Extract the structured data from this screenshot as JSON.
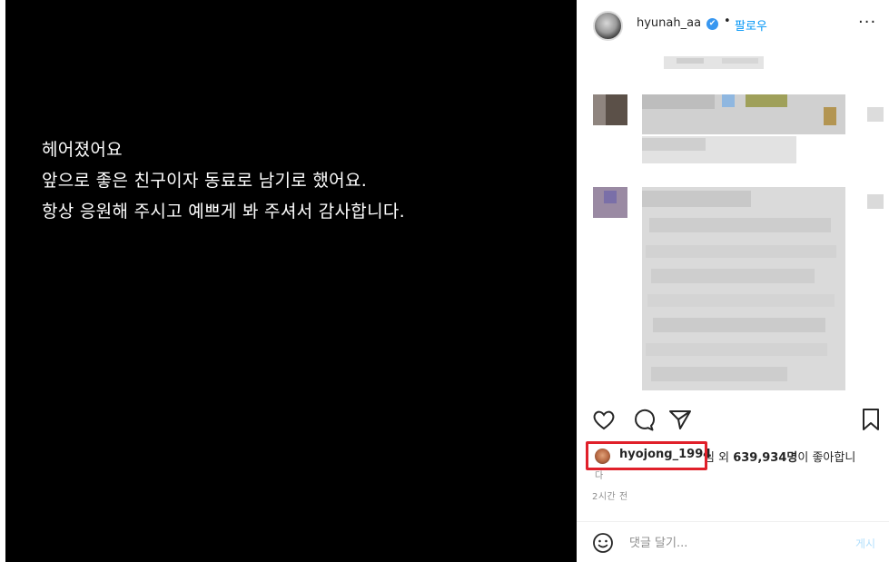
{
  "post": {
    "lines": [
      "헤어졌어요",
      "앞으로 좋은 친구이자 동료로 남기로 했어요.",
      "항상 응원해 주시고 예쁘게 봐 주셔서 감사합니다."
    ]
  },
  "header": {
    "username": "hyunah_aa",
    "verified_mark": "✔",
    "separator": "•",
    "follow_label": "팔로우",
    "more_label": "···"
  },
  "likes": {
    "liker_name": "hyojong_1994",
    "rest_prefix": "님 외 ",
    "count": "639,934명",
    "rest_suffix": "이 좋아합니",
    "continuation": "다"
  },
  "meta": {
    "time_ago": "2시간 전"
  },
  "comment": {
    "placeholder": "댓글 달기...",
    "post_label": "게시"
  },
  "icons": {
    "like": "heart-icon",
    "comment": "comment-bubble-icon",
    "share": "paper-plane-icon",
    "save": "bookmark-icon",
    "emoji": "smiley-icon",
    "more": "ellipsis-icon",
    "verified": "verified-badge-icon"
  },
  "colors": {
    "post_background": "#000000",
    "post_text": "#ffffff",
    "link_blue": "#0095f6",
    "verified_blue": "#3897f0",
    "highlight_red": "#e0202a",
    "muted_text": "#8e8e8e"
  }
}
